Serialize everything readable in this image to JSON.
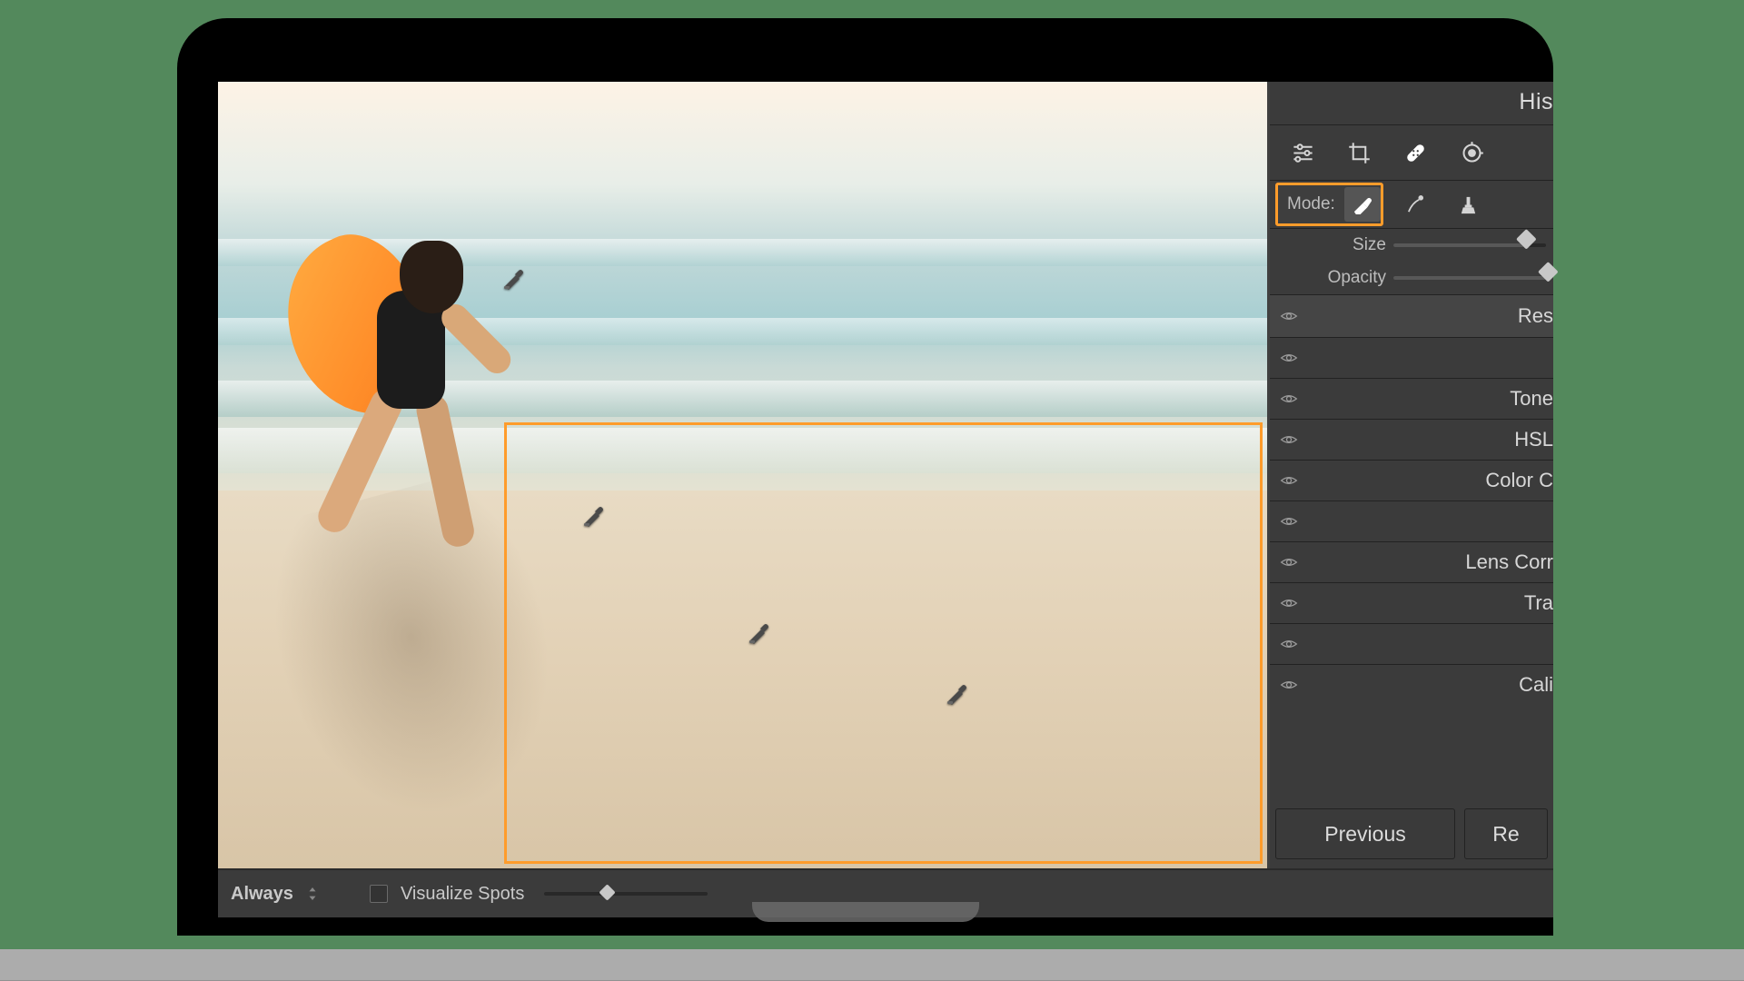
{
  "sidebar": {
    "panel_title": "His",
    "mode_label": "Mode:",
    "sliders": {
      "size_label": "Size",
      "opacity_label": "Opacity",
      "size_pct": 86,
      "opacity_pct": 100
    },
    "reset_row": "Res",
    "groups": [
      {
        "label": ""
      },
      {
        "label": "Tone"
      },
      {
        "label": "HSL"
      },
      {
        "label": "Color C"
      },
      {
        "label": ""
      },
      {
        "label": "Lens Corr"
      },
      {
        "label": "Tra"
      },
      {
        "label": ""
      },
      {
        "label": "Cali"
      }
    ],
    "buttons": {
      "previous": "Previous",
      "reset": "Re"
    }
  },
  "bottombar": {
    "overlay_label": "Always",
    "visualize_label": "Visualize Spots",
    "visualize_slider_pct": 35
  },
  "icon_names": {
    "pin": "heal-pin-icon",
    "tools": [
      "sliders-icon",
      "crop-icon",
      "bandage-icon",
      "redeye-icon"
    ],
    "modes": [
      "eraser-icon",
      "heal-brush-icon",
      "clone-stamp-icon"
    ]
  }
}
